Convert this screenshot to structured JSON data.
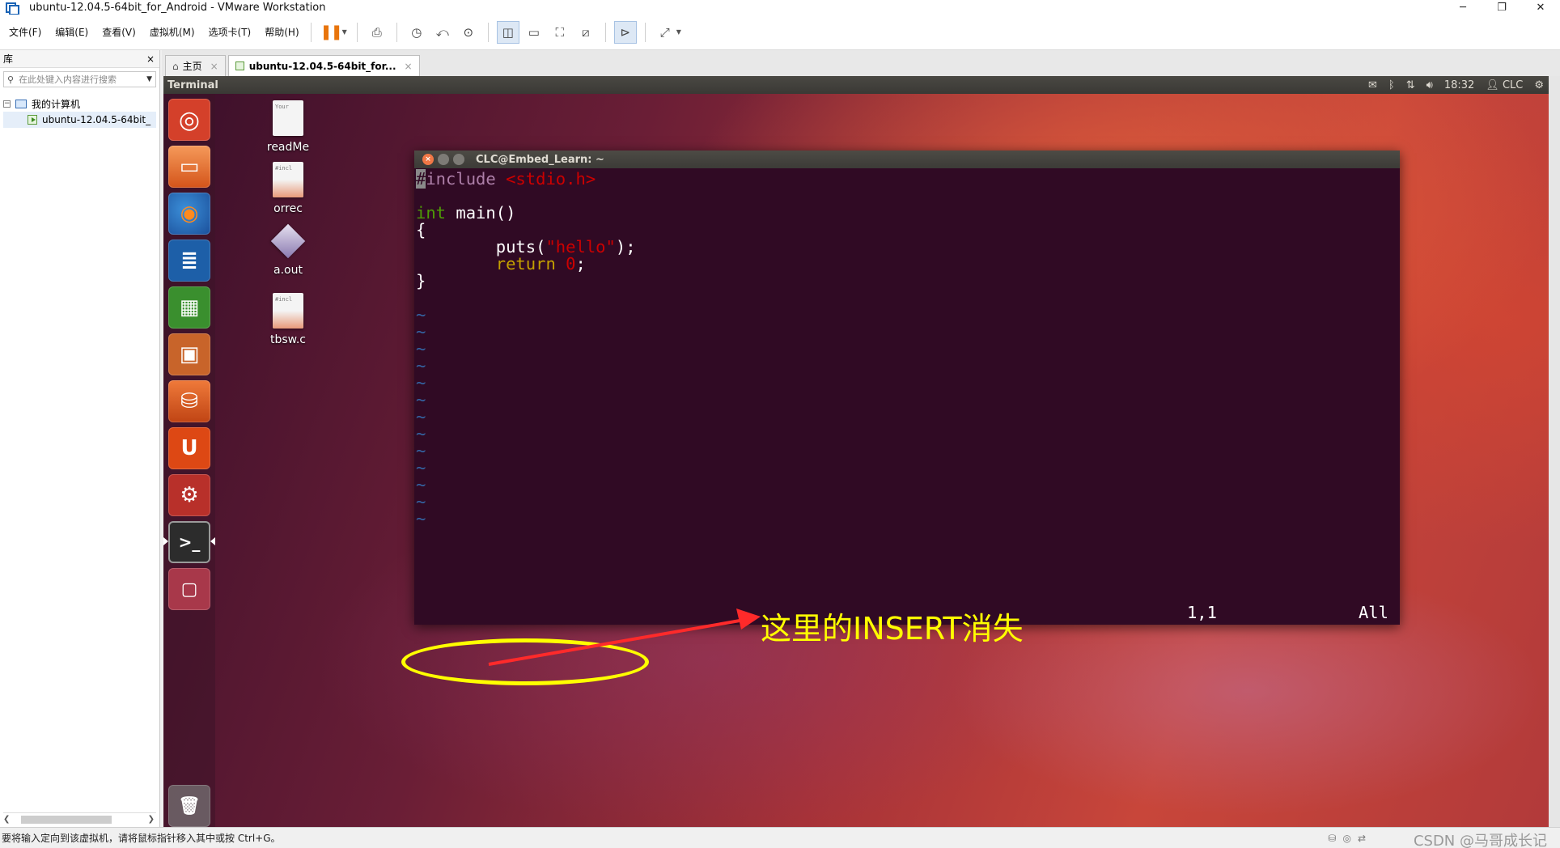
{
  "window": {
    "title": "ubuntu-12.04.5-64bit_for_Android - VMware Workstation",
    "minimize": "─",
    "restore": "❐",
    "close": "✕"
  },
  "menu": [
    "文件(F)",
    "编辑(E)",
    "查看(V)",
    "虚拟机(M)",
    "选项卡(T)",
    "帮助(H)"
  ],
  "library": {
    "title": "库",
    "close": "×",
    "search_placeholder": "在此处键入内容进行搜索",
    "tree": {
      "root": "我的计算机",
      "child": "ubuntu-12.04.5-64bit_"
    }
  },
  "tabs": [
    {
      "label": "主页",
      "close": "×"
    },
    {
      "label": "ubuntu-12.04.5-64bit_for...",
      "close": "×"
    }
  ],
  "guest": {
    "panel_title": "Terminal",
    "time": "18:32",
    "user": "CLC",
    "desktop_icons": [
      {
        "label": "readMe",
        "preview": "Your"
      },
      {
        "label": "orrec",
        "preview": "#incl"
      },
      {
        "label": "a.out",
        "preview": ""
      },
      {
        "label": "tbsw.c",
        "preview": "#incl"
      }
    ],
    "terminal": {
      "title": "CLC@Embed_Learn: ~",
      "code": {
        "l1_cursor": "#",
        "l1_kw": "include",
        "l1_str": "<stdio.h>",
        "l3_type": "int",
        "l3_rest": " main()",
        "l4": "{",
        "l5_fn": "        puts(",
        "l5_str": "\"hello\"",
        "l5_end": ");",
        "l6_kw": "        return ",
        "l6_num": "0",
        "l6_end": ";",
        "l7": "}"
      },
      "tilde": "~",
      "tilde_count": 13,
      "position": "1,1",
      "scroll": "All"
    },
    "annotation": "这里的INSERT消失"
  },
  "statusbar": {
    "message": "要将输入定向到该虚拟机，请将鼠标指针移入其中或按 Ctrl+G。",
    "watermark": "CSDN @马哥成长记"
  },
  "colors": {
    "terminal_bg": "#300a24",
    "annotation": "#ffff00",
    "ubuntu_orange": "#dd4814"
  }
}
